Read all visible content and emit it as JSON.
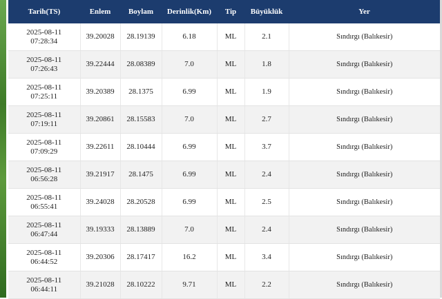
{
  "table": {
    "headers": [
      "Tarih(TS)",
      "Enlem",
      "Boylam",
      "Derinlik(Km)",
      "Tip",
      "Büyüklük",
      "Yer"
    ],
    "rows": [
      {
        "date": "2025-08-11",
        "time": "07:28:34",
        "lat": "39.20028",
        "lon": "28.19139",
        "depth": "6.18",
        "type": "ML",
        "mag": "2.1",
        "place": "Sındırgı (Balıkesir)"
      },
      {
        "date": "2025-08-11",
        "time": "07:26:43",
        "lat": "39.22444",
        "lon": "28.08389",
        "depth": "7.0",
        "type": "ML",
        "mag": "1.8",
        "place": "Sındırgı (Balıkesir)"
      },
      {
        "date": "2025-08-11",
        "time": "07:25:11",
        "lat": "39.20389",
        "lon": "28.1375",
        "depth": "6.99",
        "type": "ML",
        "mag": "1.9",
        "place": "Sındırgı (Balıkesir)"
      },
      {
        "date": "2025-08-11",
        "time": "07:19:11",
        "lat": "39.20861",
        "lon": "28.15583",
        "depth": "7.0",
        "type": "ML",
        "mag": "2.7",
        "place": "Sındırgı (Balıkesir)"
      },
      {
        "date": "2025-08-11",
        "time": "07:09:29",
        "lat": "39.22611",
        "lon": "28.10444",
        "depth": "6.99",
        "type": "ML",
        "mag": "3.7",
        "place": "Sındırgı (Balıkesir)"
      },
      {
        "date": "2025-08-11",
        "time": "06:56:28",
        "lat": "39.21917",
        "lon": "28.1475",
        "depth": "6.99",
        "type": "ML",
        "mag": "2.4",
        "place": "Sındırgı (Balıkesir)"
      },
      {
        "date": "2025-08-11",
        "time": "06:55:41",
        "lat": "39.24028",
        "lon": "28.20528",
        "depth": "6.99",
        "type": "ML",
        "mag": "2.5",
        "place": "Sındırgı (Balıkesir)"
      },
      {
        "date": "2025-08-11",
        "time": "06:47:44",
        "lat": "39.19333",
        "lon": "28.13889",
        "depth": "7.0",
        "type": "ML",
        "mag": "2.4",
        "place": "Sındırgı (Balıkesir)"
      },
      {
        "date": "2025-08-11",
        "time": "06:44:52",
        "lat": "39.20306",
        "lon": "28.17417",
        "depth": "16.2",
        "type": "ML",
        "mag": "3.4",
        "place": "Sındırgı (Balıkesir)"
      },
      {
        "date": "2025-08-11",
        "time": "06:44:11",
        "lat": "39.21028",
        "lon": "28.10222",
        "depth": "9.71",
        "type": "ML",
        "mag": "2.2",
        "place": "Sındırgı (Balıkesir)"
      }
    ]
  },
  "colors": {
    "header_bg": "#1c3c6e",
    "header_text": "#ffffff",
    "row_alt_bg": "#f2f2f2"
  }
}
